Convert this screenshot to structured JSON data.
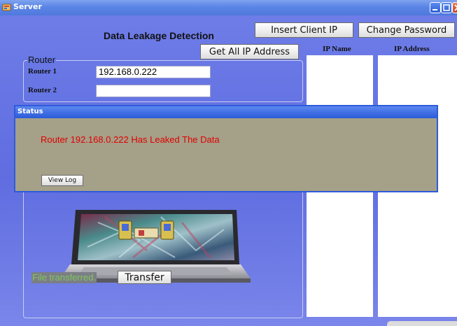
{
  "window": {
    "title": "Server"
  },
  "main": {
    "heading": "Data Leakage Detection",
    "insert_client_ip": "Insert Client IP",
    "change_password": "Change Password",
    "get_all_ip": "Get All IP Address"
  },
  "router_group": {
    "legend": "Router",
    "router1_label": "Router 1",
    "router1_value": "192.168.0.222",
    "router2_label": "Router 2",
    "router2_value": ""
  },
  "lists": {
    "ip_name_header": "IP Name",
    "ip_address_header": "IP Address"
  },
  "status": {
    "title": "Status",
    "message": "Router 192.168.0.222 Has Leaked The Data",
    "view_log": "View Log"
  },
  "transfer": {
    "status_text": "File transferred.",
    "button": "Transfer"
  },
  "colors": {
    "window_bg": "#6f7ee8",
    "alert_text": "#e00000",
    "status_panel": "#a5a088",
    "success_text": "#7ec85a"
  }
}
